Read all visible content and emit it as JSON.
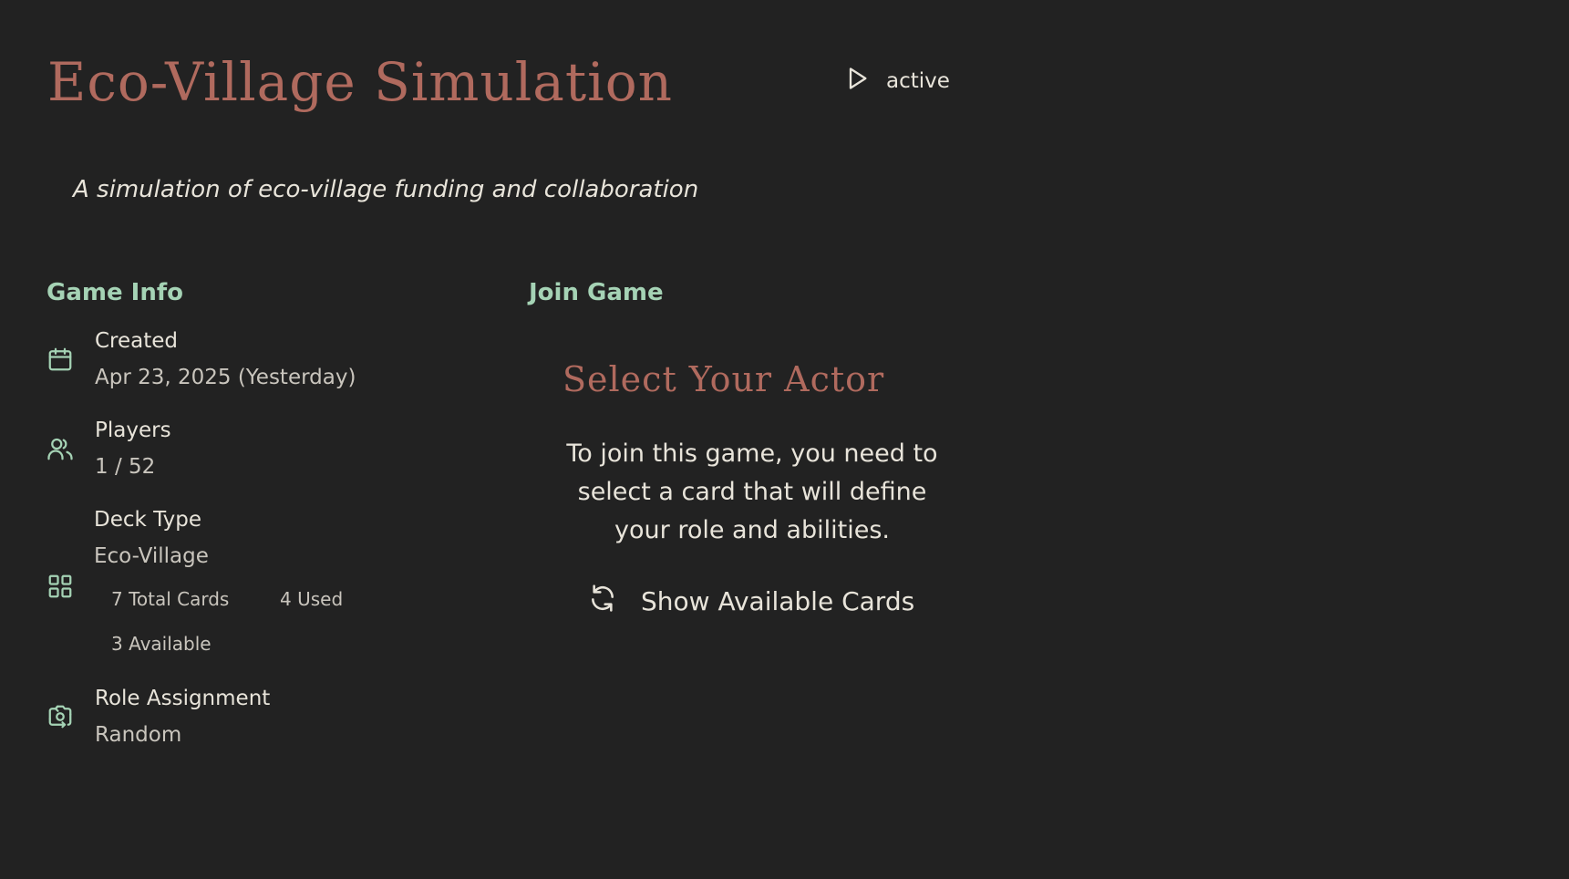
{
  "header": {
    "title": "Eco-Village Simulation",
    "status": "active",
    "status_icon": "play-icon",
    "subtitle": "A simulation of eco-village funding and collaboration"
  },
  "game_info": {
    "heading": "Game Info",
    "created": {
      "label": "Created",
      "value": "Apr 23, 2025 (Yesterday)",
      "icon": "calendar-icon"
    },
    "players": {
      "label": "Players",
      "value": "1 / 52",
      "icon": "users-icon"
    },
    "deck": {
      "label": "Deck Type",
      "value": "Eco-Village",
      "icon": "grid-icon",
      "total": "7 Total Cards",
      "used": "4 Used",
      "available": "3 Available"
    },
    "role": {
      "label": "Role Assignment",
      "value": "Random",
      "icon": "camera-rotate-icon"
    }
  },
  "join_game": {
    "heading": "Join Game",
    "actor_title": "Select Your Actor",
    "description": "To join this game, you need to select a card that will define your role and abilities.",
    "show_cards_label": "Show Available Cards",
    "show_cards_icon": "refresh-icon"
  },
  "colors": {
    "background": "#222222",
    "title": "#b06a5e",
    "section_heading": "#a5d3b5",
    "icon": "#a5d3b5",
    "text": "#e8e4da"
  }
}
